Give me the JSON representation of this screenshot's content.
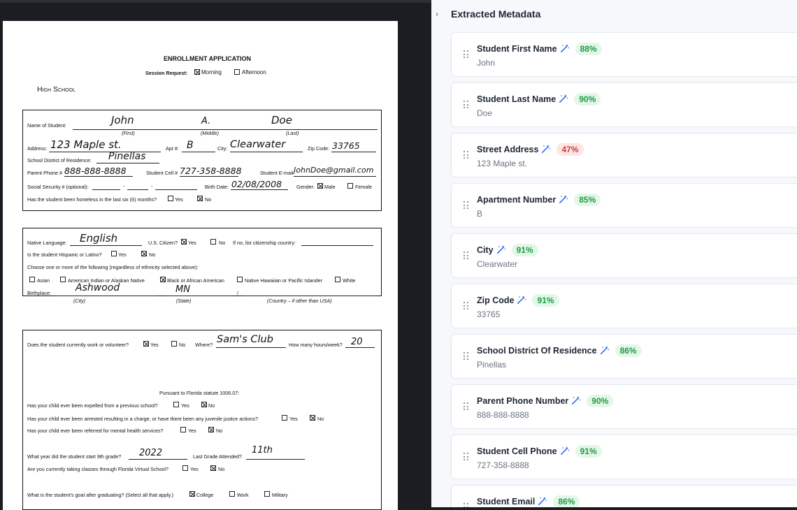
{
  "document": {
    "title": "ENROLLMENT APPLICATION",
    "session_request_label": "Session Request:",
    "session_morning": "Morning",
    "session_afternoon": "Afternoon",
    "school_label": "High School",
    "section1": {
      "name_label": "Name of Student:",
      "first": "John",
      "middle": "A.",
      "last": "Doe",
      "first_caption": "(First)",
      "middle_caption": "(Middle)",
      "last_caption": "(Last)",
      "address_label": "Address:",
      "address": "123 Maple st.",
      "apt_label": "Apt #:",
      "apt": "B",
      "city_label": "City:",
      "city": "Clearwater",
      "zip_label": "Zip Code:",
      "zip": "33765",
      "district_label": "School District of Residence:",
      "district": "Pinellas",
      "parent_phone_label": "Parent Phone #",
      "parent_phone": "888-888-8888",
      "cell_label": "Student Cell #",
      "cell": "727-358-8888",
      "email_label": "Student E-mail",
      "email": "JohnDoe@gmail.com",
      "ssn_label": "Social Security # (optional):",
      "ssn_sep1": "-",
      "ssn_sep2": "-",
      "birth_label": "Birth Date:",
      "birth": "02/08/2008",
      "gender_label": "Gender:",
      "male": "Male",
      "female": "Female",
      "homeless_label": "Has the student been homeless in the last six (6) months?",
      "yes": "Yes",
      "no": "No"
    },
    "section2": {
      "lang_label": "Native Language:",
      "lang": "English",
      "citizen_label": "U.S. Citizen?",
      "yes": "Yes",
      "no": "No",
      "country_label": "If no, list citizenship country:",
      "hispanic_label": "Is the student Hispanic or Latino?",
      "choose_label": "Choose one or more of the following (regardless of ethnicity selected above):",
      "asian": "Asian",
      "amind": "American Indian or Alaskan Native",
      "black": "Black or African American",
      "hawaiian": "Native Hawaiian or Pacific Islander",
      "white": "White",
      "birthplace_label": "Birthplace:",
      "birth_city": "Ashwood",
      "birth_state": "MN",
      "slash": "/",
      "city_caption": "(City)",
      "state_caption": "(State)",
      "country_caption": "(Country – if other than USA)"
    },
    "section3": {
      "work_label": "Does the student currently work or volunteer?",
      "yes": "Yes",
      "no": "No",
      "where_label": "Where?",
      "where": "Sam's Club",
      "hours_label": "How many hours/week?",
      "hours": "20",
      "statute": "Pursuant to Florida statute 1006.07:",
      "expelled_label": "Has your child ever been expelled from a previous school?",
      "arrested_label": "Has your child ever been arrested resulting in a charge, or have there been any juvenile justice actions?",
      "referred_label": "Has your child ever been referred for mental health services?",
      "ninth_label": "What year did the student start 9th grade?",
      "ninth": "2022",
      "last_grade_label": "Last Grade Attended?",
      "last_grade": "11th",
      "virtual_label": "Are you currently taking classes through Florida Virtual School?",
      "goal_label": "What is the student's goal after graduating? (Select all that apply.)",
      "college": "College",
      "work": "Work",
      "military": "Military"
    }
  },
  "panel": {
    "toggle_glyph": "›",
    "title": "Extracted Metadata",
    "fields": [
      {
        "name": "Student First Name",
        "value": "John",
        "confidence": "88%",
        "status": "good"
      },
      {
        "name": "Student Last Name",
        "value": "Doe",
        "confidence": "90%",
        "status": "good"
      },
      {
        "name": "Street Address",
        "value": "123 Maple st.",
        "confidence": "47%",
        "status": "bad"
      },
      {
        "name": "Apartment Number",
        "value": "B",
        "confidence": "85%",
        "status": "good"
      },
      {
        "name": "City",
        "value": "Clearwater",
        "confidence": "91%",
        "status": "good"
      },
      {
        "name": "Zip Code",
        "value": "33765",
        "confidence": "91%",
        "status": "good"
      },
      {
        "name": "School District Of Residence",
        "value": "Pinellas",
        "confidence": "86%",
        "status": "good"
      },
      {
        "name": "Parent Phone Number",
        "value": "888-888-8888",
        "confidence": "90%",
        "status": "good"
      },
      {
        "name": "Student Cell Phone",
        "value": "727-358-8888",
        "confidence": "91%",
        "status": "good"
      },
      {
        "name": "Student Email",
        "value": "",
        "confidence": "86%",
        "status": "good"
      }
    ]
  },
  "colors": {
    "good_text": "#1f9a45",
    "good_bg": "#e3f7e8",
    "bad_text": "#d23c3c",
    "bad_bg": "#fde6e6",
    "accent": "#2563eb"
  }
}
